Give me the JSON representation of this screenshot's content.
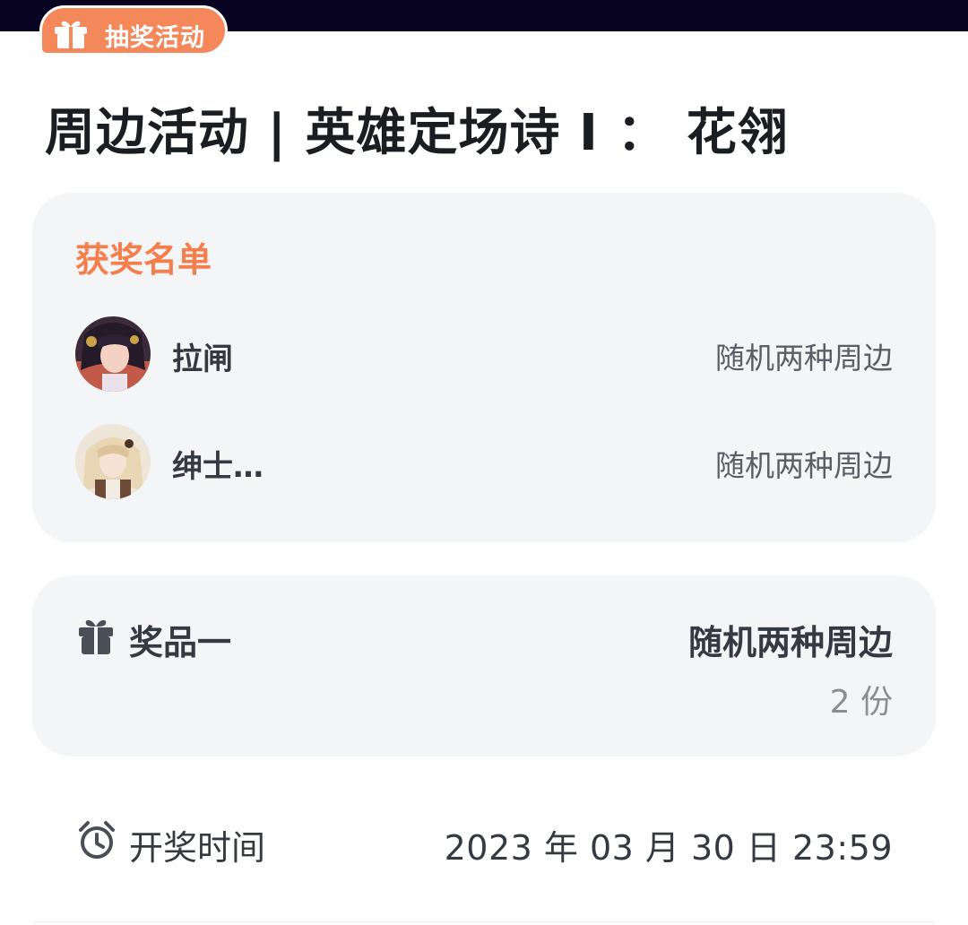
{
  "badge": {
    "label": "抽奖活动",
    "icon": "gift-icon"
  },
  "title": "周边活动 | 英雄定场诗 Ⅰ ： 花翎",
  "winners": {
    "heading": "获奖名单",
    "items": [
      {
        "name": "拉闸",
        "prize": "随机两种周边",
        "avatar": "avatar-dark-hair-character"
      },
      {
        "name": "绅士…",
        "prize": "随机两种周边",
        "avatar": "avatar-blonde-character"
      }
    ]
  },
  "prize": {
    "label": "奖品一",
    "icon": "gift-icon",
    "name": "随机两种周边",
    "quantity": "2 份"
  },
  "draw": {
    "label": "开奖时间",
    "icon": "alarm-clock-icon",
    "time": "2023 年 03 月 30 日 23:59"
  },
  "colors": {
    "accent": "#f5885a",
    "heading_accent": "#f47f4d",
    "card_bg": "#f4f5f7",
    "top_bar": "#06021f"
  }
}
